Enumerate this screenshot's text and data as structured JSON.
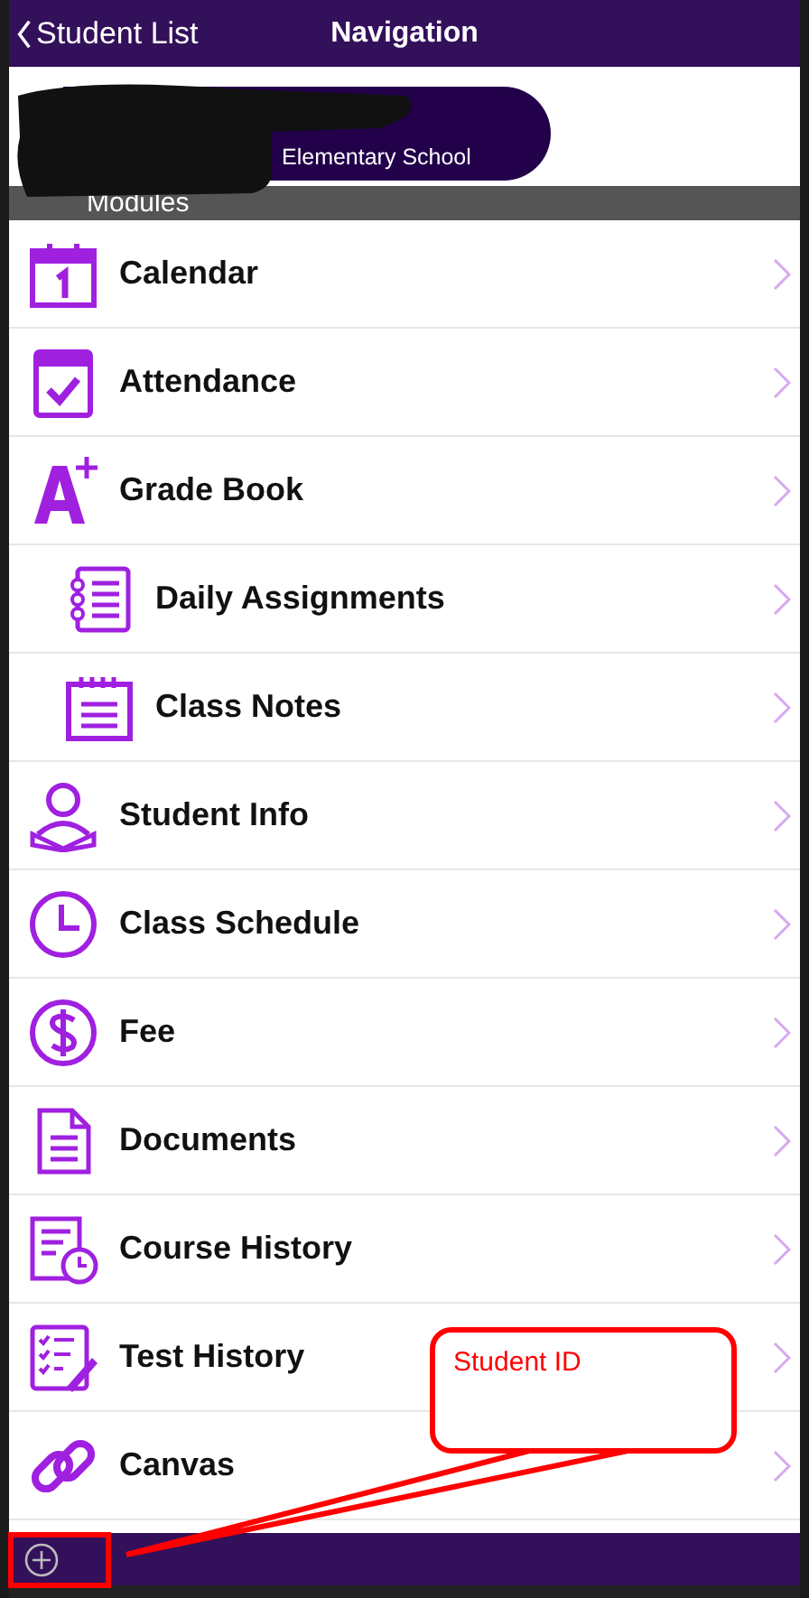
{
  "header": {
    "back_label": "Student List",
    "title": "Navigation"
  },
  "banner": {
    "school": "Elementary School"
  },
  "section": {
    "title": "Modules"
  },
  "modules": [
    {
      "label": "Calendar"
    },
    {
      "label": "Attendance"
    },
    {
      "label": "Grade Book",
      "children": [
        {
          "label": "Daily Assignments"
        },
        {
          "label": "Class Notes"
        }
      ]
    },
    {
      "label": "Student Info"
    },
    {
      "label": "Class Schedule"
    },
    {
      "label": "Fee"
    },
    {
      "label": "Documents"
    },
    {
      "label": "Course History"
    },
    {
      "label": "Test History"
    },
    {
      "label": "Canvas"
    }
  ],
  "annotation": {
    "text": "Student ID"
  }
}
